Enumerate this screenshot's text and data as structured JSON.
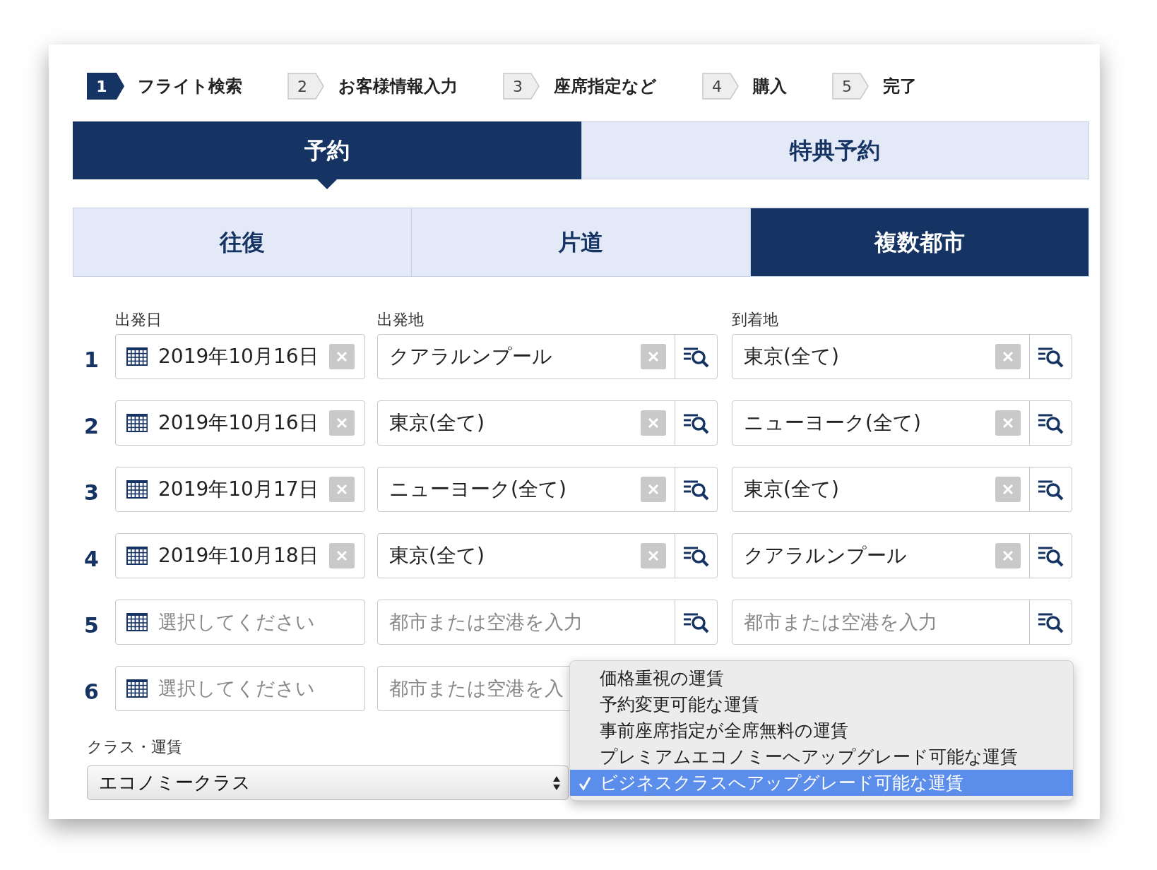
{
  "steps": [
    {
      "number": "1",
      "label": "フライト検索",
      "selected": true
    },
    {
      "number": "2",
      "label": "お客様情報入力",
      "selected": false
    },
    {
      "number": "3",
      "label": "座席指定など",
      "selected": false
    },
    {
      "number": "4",
      "label": "購入",
      "selected": false
    },
    {
      "number": "5",
      "label": "完了",
      "selected": false
    }
  ],
  "booking_tabs": [
    {
      "label": "予約",
      "selected": true
    },
    {
      "label": "特典予約",
      "selected": false
    }
  ],
  "trip_types": [
    {
      "label": "往復",
      "selected": false
    },
    {
      "label": "片道",
      "selected": false
    },
    {
      "label": "複数都市",
      "selected": true
    }
  ],
  "columns": [
    "出発日",
    "出発地",
    "到着地"
  ],
  "legs": [
    {
      "number": "1",
      "date": {
        "value": "2019年10月16日"
      },
      "origin": {
        "value": "クアラルンプール"
      },
      "destination": {
        "value": "東京(全て)"
      }
    },
    {
      "number": "2",
      "date": {
        "value": "2019年10月16日"
      },
      "origin": {
        "value": "東京(全て)"
      },
      "destination": {
        "value": "ニューヨーク(全て)"
      }
    },
    {
      "number": "3",
      "date": {
        "value": "2019年10月17日"
      },
      "origin": {
        "value": "ニューヨーク(全て)"
      },
      "destination": {
        "value": "東京(全て)"
      }
    },
    {
      "number": "4",
      "date": {
        "value": "2019年10月18日"
      },
      "origin": {
        "value": "東京(全て)"
      },
      "destination": {
        "value": "クアラルンプール"
      }
    },
    {
      "number": "5",
      "date": {
        "placeholder": "選択してください"
      },
      "origin": {
        "placeholder": "都市または空港を入力"
      },
      "destination": {
        "placeholder": "都市または空港を入力"
      }
    },
    {
      "number": "6",
      "date": {
        "placeholder": "選択してください"
      },
      "origin": {
        "placeholder": "都市または空港を入"
      }
    }
  ],
  "class_fare": {
    "label": "クラス・運賃",
    "value": "エコノミークラス"
  },
  "fare_menu": [
    {
      "label": "価格重視の運賃",
      "selected": false
    },
    {
      "label": "予約変更可能な運賃",
      "selected": false
    },
    {
      "label": "事前座席指定が全席無料の運賃",
      "selected": false
    },
    {
      "label": "プレミアムエコノミーへアップグレード可能な運賃",
      "selected": false
    },
    {
      "label": "ビジネスクラスへアップグレード可能な運賃",
      "selected": true
    }
  ]
}
